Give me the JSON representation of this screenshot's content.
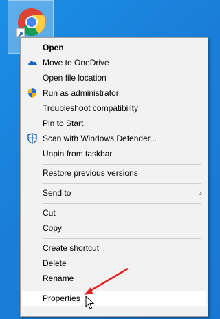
{
  "desktop": {
    "icon": "chrome-icon"
  },
  "menu": {
    "items": [
      {
        "label": "Open"
      },
      {
        "label": "Move to OneDrive",
        "icon": "onedrive-cloud-icon"
      },
      {
        "label": "Open file location"
      },
      {
        "label": "Run as administrator",
        "icon": "uac-shield-icon"
      },
      {
        "label": "Troubleshoot compatibility"
      },
      {
        "label": "Pin to Start"
      },
      {
        "label": "Scan with Windows Defender...",
        "icon": "defender-icon"
      },
      {
        "label": "Unpin from taskbar"
      },
      {
        "label": "Restore previous versions"
      },
      {
        "label": "Send to"
      },
      {
        "label": "Cut"
      },
      {
        "label": "Copy"
      },
      {
        "label": "Create shortcut"
      },
      {
        "label": "Delete"
      },
      {
        "label": "Rename"
      },
      {
        "label": "Properties"
      }
    ]
  },
  "colors": {
    "accent_arrow": "#e02020",
    "desktop_bg": "#1a84de"
  }
}
